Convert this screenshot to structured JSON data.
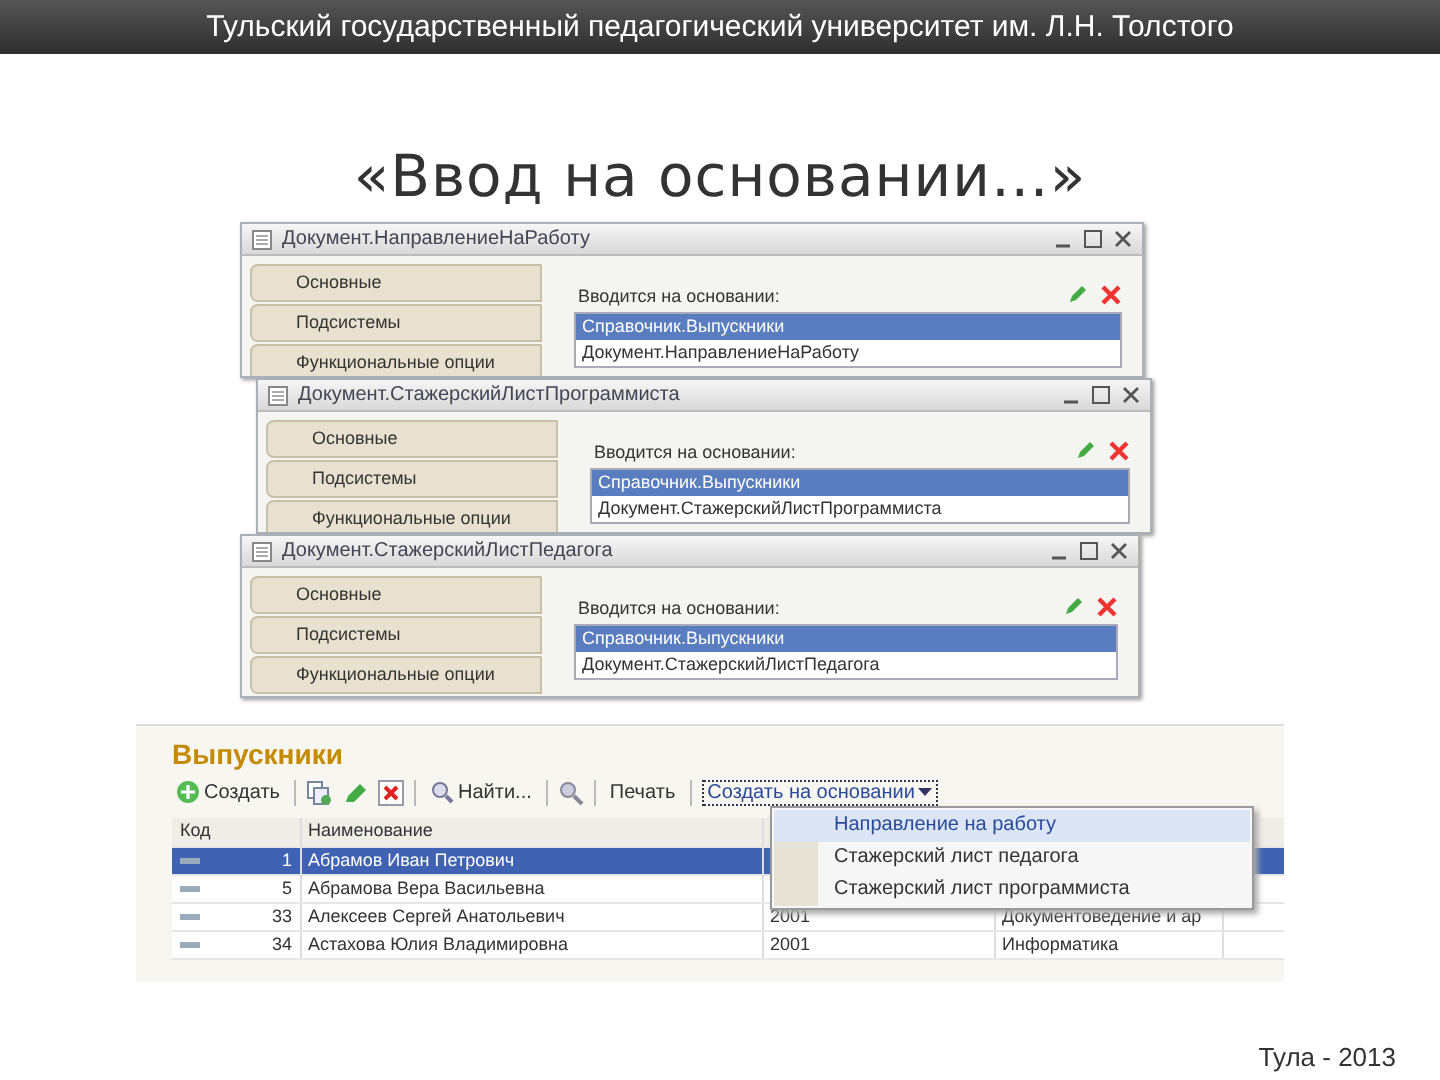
{
  "header": {
    "title": "Тульский государственный педагогический университет им. Л.Н. Толстого"
  },
  "slide_title": "«Ввод на основании…»",
  "windows": [
    {
      "title": "Документ.НаправлениеНаРаботу",
      "tabs": [
        {
          "label": "Основные"
        },
        {
          "label": "Подсистемы"
        },
        {
          "label": "Функциональные опции"
        }
      ],
      "field_label": "Вводится на основании:",
      "list": [
        {
          "text": "Справочник.Выпускники",
          "selected": true
        },
        {
          "text": "Документ.НаправлениеНаРаботу",
          "selected": false
        }
      ]
    },
    {
      "title": "Документ.СтажерскийЛистПрограммиста",
      "tabs": [
        {
          "label": "Основные"
        },
        {
          "label": "Подсистемы"
        },
        {
          "label": "Функциональные опции"
        }
      ],
      "field_label": "Вводится на основании:",
      "list": [
        {
          "text": "Справочник.Выпускники",
          "selected": true
        },
        {
          "text": "Документ.СтажерскийЛистПрограммиста",
          "selected": false
        }
      ]
    },
    {
      "title": "Документ.СтажерскийЛистПедагога",
      "tabs": [
        {
          "label": "Основные"
        },
        {
          "label": "Подсистемы"
        },
        {
          "label": "Функциональные опции"
        }
      ],
      "field_label": "Вводится на основании:",
      "list": [
        {
          "text": "Справочник.Выпускники",
          "selected": true
        },
        {
          "text": "Документ.СтажерскийЛистПедагога",
          "selected": false
        }
      ]
    }
  ],
  "list_form": {
    "title": "Выпускники",
    "toolbar": [
      {
        "kind": "button",
        "label": "Создать"
      },
      {
        "kind": "separator"
      },
      {
        "kind": "icon"
      },
      {
        "kind": "icon"
      },
      {
        "kind": "icon"
      },
      {
        "kind": "separator"
      },
      {
        "kind": "button",
        "label": "Найти..."
      },
      {
        "kind": "separator"
      },
      {
        "kind": "icon"
      },
      {
        "kind": "separator"
      },
      {
        "kind": "button",
        "label": "Печать"
      },
      {
        "kind": "separator"
      },
      {
        "kind": "menu_button",
        "label": "Создать на основании"
      }
    ],
    "columns": [
      "Код",
      "Наименование"
    ],
    "rows": [
      {
        "code": "1",
        "name": "Абрамов Иван Петрович",
        "selected": true,
        "cells": []
      },
      {
        "code": "5",
        "name": "Абрамова Вера Васильевна",
        "selected": false,
        "cells": []
      },
      {
        "code": "33",
        "name": "Алексеев Сергей Анатольевич",
        "selected": false,
        "cells": [
          "2001",
          "Документоведение и ар"
        ]
      },
      {
        "code": "34",
        "name": "Астахова Юлия Владимировна",
        "selected": false,
        "cells": [
          "2001",
          "Информатика"
        ]
      }
    ],
    "menu": [
      {
        "label": "Направление на работу",
        "selected": true
      },
      {
        "label": "Стажерский лист педагога",
        "selected": false
      },
      {
        "label": "Стажерский лист программиста",
        "selected": false
      }
    ]
  },
  "footer": "Тула - 2013"
}
